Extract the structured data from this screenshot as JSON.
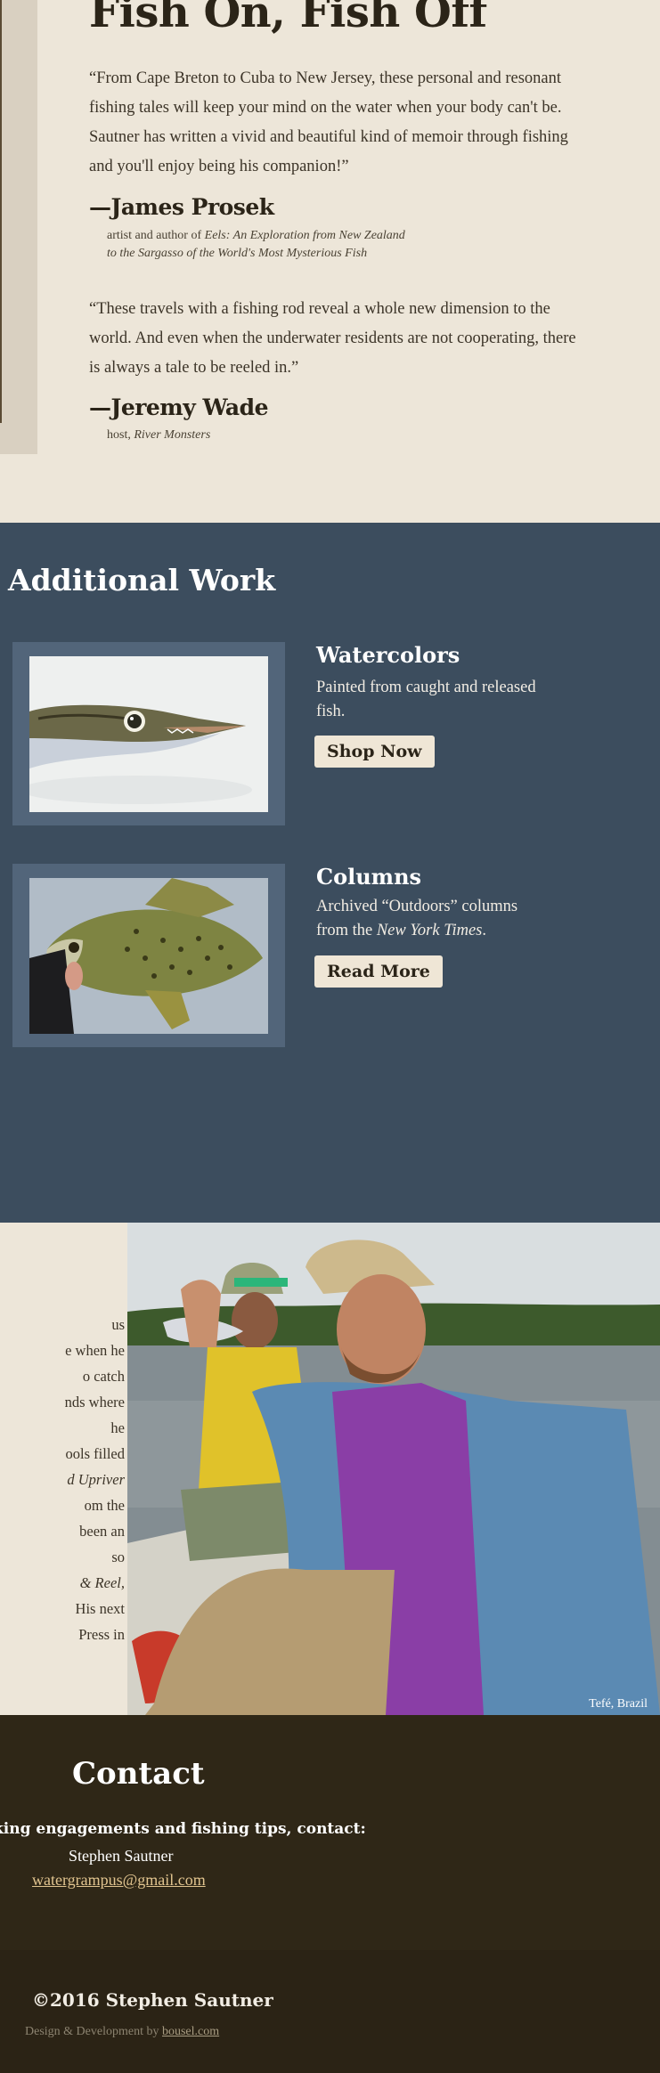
{
  "header": {
    "title": "Fish On, Fish Off"
  },
  "testimonials": [
    {
      "quote": "“From Cape Breton to Cuba to New Jersey, these personal and resonant fishing tales will keep your mind on the water when your body can't be. Sautner has written a vivid and beautiful kind of memoir through fishing and you'll enjoy being his companion!”",
      "name": "—James Prosek",
      "credit_line1_prefix": "artist and author of ",
      "credit_line1_italic": "Eels: An Exploration from New Zealand",
      "credit_line2_italic": "to the Sargasso of the World's Most Mysterious Fish"
    },
    {
      "quote": "“These travels with a fishing rod reveal a whole new dimension to the world. And even when the underwater residents are not cooperating, there is always a tale to be reeled in.”",
      "name": "—Jeremy Wade",
      "credit_prefix": "host, ",
      "credit_italic": "River Monsters"
    }
  ],
  "work": {
    "title": "Additional Work",
    "items": [
      {
        "title": "Watercolors",
        "text": "Painted from caught and released fish.",
        "button": "Shop Now",
        "image_icon": "barracuda-watercolor-image"
      },
      {
        "title": "Columns",
        "text_prefix": "Archived “Outdoors” columns from the ",
        "text_italic": "New York Times",
        "text_suffix": ".",
        "button": "Read More",
        "image_icon": "crappie-fish-image"
      }
    ]
  },
  "about": {
    "lines": [
      "us",
      "e when he",
      "o catch",
      "nds where",
      "he",
      "ools filled",
      "d Upriver",
      "om the",
      "been an",
      "so",
      "& Reel,",
      "His next",
      "Press in"
    ],
    "photo_caption": "Tefé, Brazil"
  },
  "contact": {
    "title": "Contact",
    "label": "king engagements and fishing tips, contact:",
    "name": "Stephen Sautner",
    "email": "watergrampus@gmail.com"
  },
  "footer": {
    "copyright": "©2016 Stephen Sautner",
    "credit_prefix": "Design & Development by ",
    "credit_link": "bousel.com"
  },
  "colors": {
    "page_bg": "#ede6d9",
    "work_bg": "#3c4d5e",
    "contact_bg": "#2f2717",
    "footer_bg": "#2b2315",
    "email_link": "#e1c48f"
  }
}
